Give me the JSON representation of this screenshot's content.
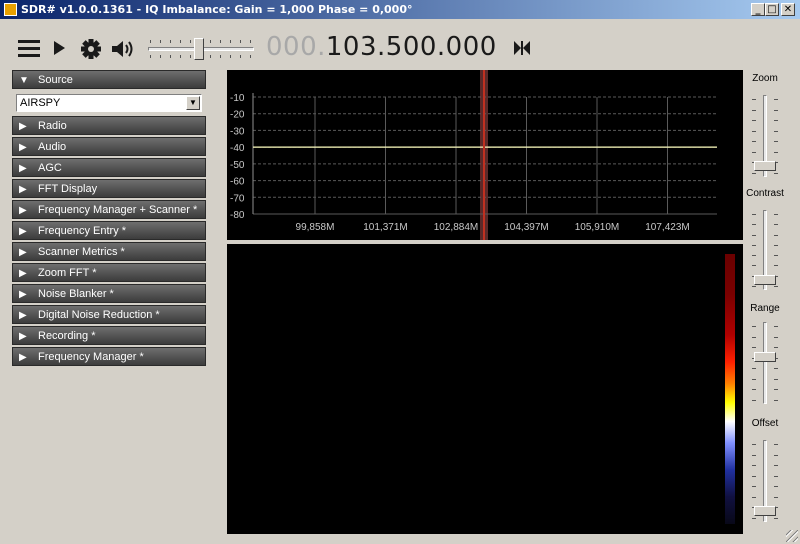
{
  "window": {
    "title": "SDR# v1.0.0.1361 - IQ Imbalance: Gain = 1,000 Phase = 0,000°",
    "minimize": "_",
    "maximize": "□",
    "close": "✕"
  },
  "toolbar": {
    "icons": [
      "menu-icon",
      "play-icon",
      "gear-icon",
      "speaker-icon",
      "tune-icon"
    ],
    "volume_level": 0.48,
    "frequency_dim": "000.",
    "frequency_main": "103.500.000"
  },
  "source": {
    "header": "Source",
    "arrow": "▼",
    "selected": "AIRSPY"
  },
  "panels": [
    {
      "label": "Radio",
      "arrow": "▶"
    },
    {
      "label": "Audio",
      "arrow": "▶"
    },
    {
      "label": "AGC",
      "arrow": "▶"
    },
    {
      "label": "FFT Display",
      "arrow": "▶"
    },
    {
      "label": "Frequency Manager + Scanner *",
      "arrow": "▶"
    },
    {
      "label": "Frequency Entry *",
      "arrow": "▶"
    },
    {
      "label": "Scanner Metrics *",
      "arrow": "▶"
    },
    {
      "label": "Zoom FFT *",
      "arrow": "▶"
    },
    {
      "label": "Noise Blanker *",
      "arrow": "▶"
    },
    {
      "label": "Digital Noise Reduction *",
      "arrow": "▶"
    },
    {
      "label": "Recording *",
      "arrow": "▶"
    },
    {
      "label": "Frequency Manager *",
      "arrow": "▶"
    }
  ],
  "spectrum": {
    "y_ticks": [
      "-10",
      "-20",
      "-30",
      "-40",
      "-50",
      "-60",
      "-70",
      "-80"
    ],
    "x_ticks": [
      "99,858M",
      "101,371M",
      "102,884M",
      "104,397M",
      "105,910M",
      "107,423M"
    ],
    "trace_level_db": -40,
    "colors": {
      "trace": "#ffffc0",
      "grid": "#5a5a5a",
      "marker": "#c03020",
      "band": "#5a2a2a"
    }
  },
  "right_sliders": [
    {
      "label": "Zoom",
      "level": 0.05
    },
    {
      "label": "Contrast",
      "level": 0.05
    },
    {
      "label": "Range",
      "level": 0.55
    },
    {
      "label": "Offset",
      "level": 0.05
    }
  ]
}
